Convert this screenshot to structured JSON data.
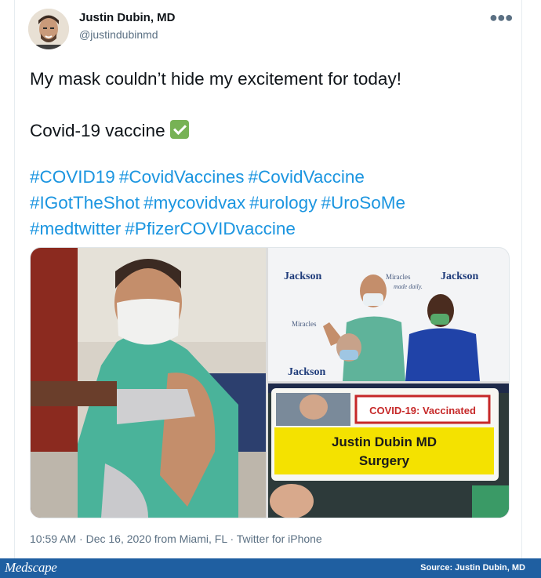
{
  "tweet": {
    "author_name": "Justin Dubin, MD",
    "handle": "@justindubinmd",
    "more_icon": "more-icon",
    "line1": "My mask couldn’t hide my excitement for today!",
    "line2": "Covid-19 vaccine",
    "check_icon": "check-mark-button-emoji",
    "hashtags": [
      "#COVID19",
      "#CovidVaccines",
      "#CovidVaccine",
      "#IGotTheShot",
      "#mycovidvax",
      "#urology",
      "#UroSoMe",
      "#medtwitter",
      "#PfizerCOVIDvaccine"
    ],
    "timestamp_meta": "10:59 AM · Dec 16, 2020 from Miami, FL · Twitter for iPhone"
  },
  "media": {
    "sign_jackson": "Jackson",
    "sign_miracles": "Miracles",
    "sign_made_daily": "made daily.",
    "badge_status": "COVID-19: Vaccinated",
    "badge_name": "Justin Dubin MD",
    "badge_dept": "Surgery"
  },
  "footer": {
    "logo": "Medscape",
    "source": "Source: Justin Dubin, MD"
  },
  "colors": {
    "hashtag": "#1b95e0",
    "footer_bg": "#1f5fa1",
    "muted": "#5b7083",
    "check": "#77b255"
  }
}
